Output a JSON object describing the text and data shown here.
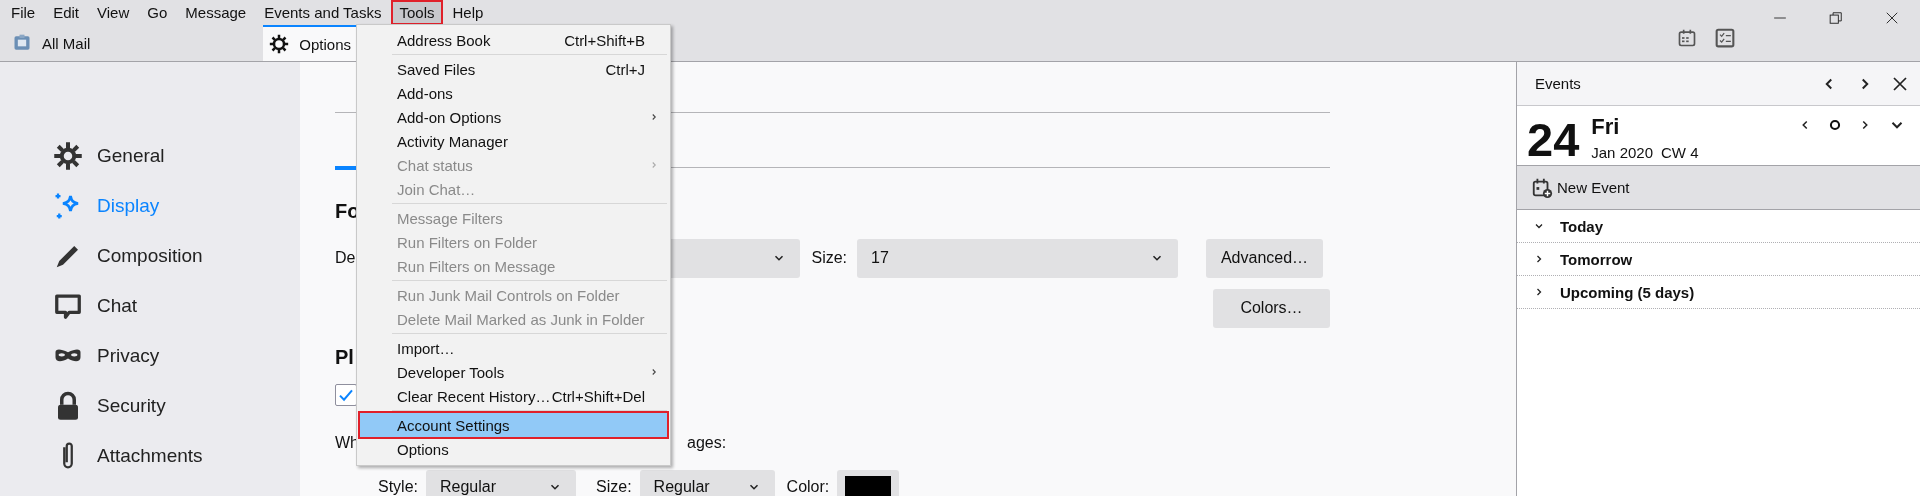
{
  "menubar": {
    "items": [
      {
        "label": "File",
        "selected": false
      },
      {
        "label": "Edit",
        "selected": false
      },
      {
        "label": "View",
        "selected": false
      },
      {
        "label": "Go",
        "selected": false
      },
      {
        "label": "Message",
        "selected": false
      },
      {
        "label": "Events and Tasks",
        "selected": false
      },
      {
        "label": "Tools",
        "selected": true
      },
      {
        "label": "Help",
        "selected": false
      }
    ]
  },
  "tabs": [
    {
      "label": "All Mail",
      "selected": false
    },
    {
      "label": "Options",
      "selected": true
    }
  ],
  "sidebar": {
    "items": [
      {
        "label": "General",
        "selected": false
      },
      {
        "label": "Display",
        "selected": true
      },
      {
        "label": "Composition",
        "selected": false
      },
      {
        "label": "Chat",
        "selected": false
      },
      {
        "label": "Privacy",
        "selected": false
      },
      {
        "label": "Security",
        "selected": false
      },
      {
        "label": "Attachments",
        "selected": false
      }
    ]
  },
  "content": {
    "heading_1": "Fo",
    "font_label": "De",
    "size_label": "Size:",
    "size_value": "17",
    "advanced_button": "Advanced…",
    "colors_button": "Colors…",
    "heading_2": "Pl",
    "checkbox": {
      "checked": true
    },
    "quoted_label_start": "Wh",
    "quoted_label_end": "ages:",
    "style_label": "Style:",
    "style_value": "Regular",
    "size2_label": "Size:",
    "size2_value": "Regular",
    "color_label": "Color:",
    "color_swatch": {
      "color": "#000000"
    }
  },
  "menu": {
    "items": [
      {
        "kind": "item",
        "label": "Address Book",
        "shortcut": "Ctrl+Shift+B",
        "disabled": false,
        "submenu": false,
        "selected": false
      },
      {
        "kind": "separator"
      },
      {
        "kind": "item",
        "label": "Saved Files",
        "shortcut": "Ctrl+J",
        "disabled": false,
        "submenu": false,
        "selected": false
      },
      {
        "kind": "item",
        "label": "Add-ons",
        "disabled": false,
        "submenu": false,
        "selected": false
      },
      {
        "kind": "item",
        "label": "Add-on Options",
        "disabled": false,
        "submenu": true,
        "selected": false
      },
      {
        "kind": "item",
        "label": "Activity Manager",
        "disabled": false,
        "submenu": false,
        "selected": false
      },
      {
        "kind": "item",
        "label": "Chat status",
        "disabled": true,
        "submenu": true,
        "selected": false
      },
      {
        "kind": "item",
        "label": "Join Chat…",
        "disabled": true,
        "submenu": false,
        "selected": false
      },
      {
        "kind": "separator"
      },
      {
        "kind": "item",
        "label": "Message Filters",
        "disabled": true,
        "submenu": false,
        "selected": false
      },
      {
        "kind": "item",
        "label": "Run Filters on Folder",
        "disabled": true,
        "submenu": false,
        "selected": false
      },
      {
        "kind": "item",
        "label": "Run Filters on Message",
        "disabled": true,
        "submenu": false,
        "selected": false
      },
      {
        "kind": "separator"
      },
      {
        "kind": "item",
        "label": "Run Junk Mail Controls on Folder",
        "disabled": true,
        "submenu": false,
        "selected": false
      },
      {
        "kind": "item",
        "label": "Delete Mail Marked as Junk in Folder",
        "disabled": true,
        "submenu": false,
        "selected": false
      },
      {
        "kind": "separator"
      },
      {
        "kind": "item",
        "label": "Import…",
        "disabled": false,
        "submenu": false,
        "selected": false
      },
      {
        "kind": "item",
        "label": "Developer Tools",
        "disabled": false,
        "submenu": true,
        "selected": false
      },
      {
        "kind": "item",
        "label": "Clear Recent History…",
        "shortcut": "Ctrl+Shift+Del",
        "disabled": false,
        "submenu": false,
        "selected": false
      },
      {
        "kind": "separator"
      },
      {
        "kind": "item",
        "label": "Account Settings",
        "disabled": false,
        "submenu": false,
        "selected": true
      },
      {
        "kind": "item",
        "label": "Options",
        "disabled": false,
        "submenu": false,
        "selected": false
      }
    ]
  },
  "events": {
    "title": "Events",
    "day": "24",
    "weekday": "Fri",
    "month": "Jan 2020",
    "week": "CW 4",
    "new_event": "New Event",
    "sections": [
      {
        "label": "Today",
        "expanded": true
      },
      {
        "label": "Tomorrow",
        "expanded": false
      },
      {
        "label": "Upcoming (5 days)",
        "expanded": false
      }
    ]
  }
}
